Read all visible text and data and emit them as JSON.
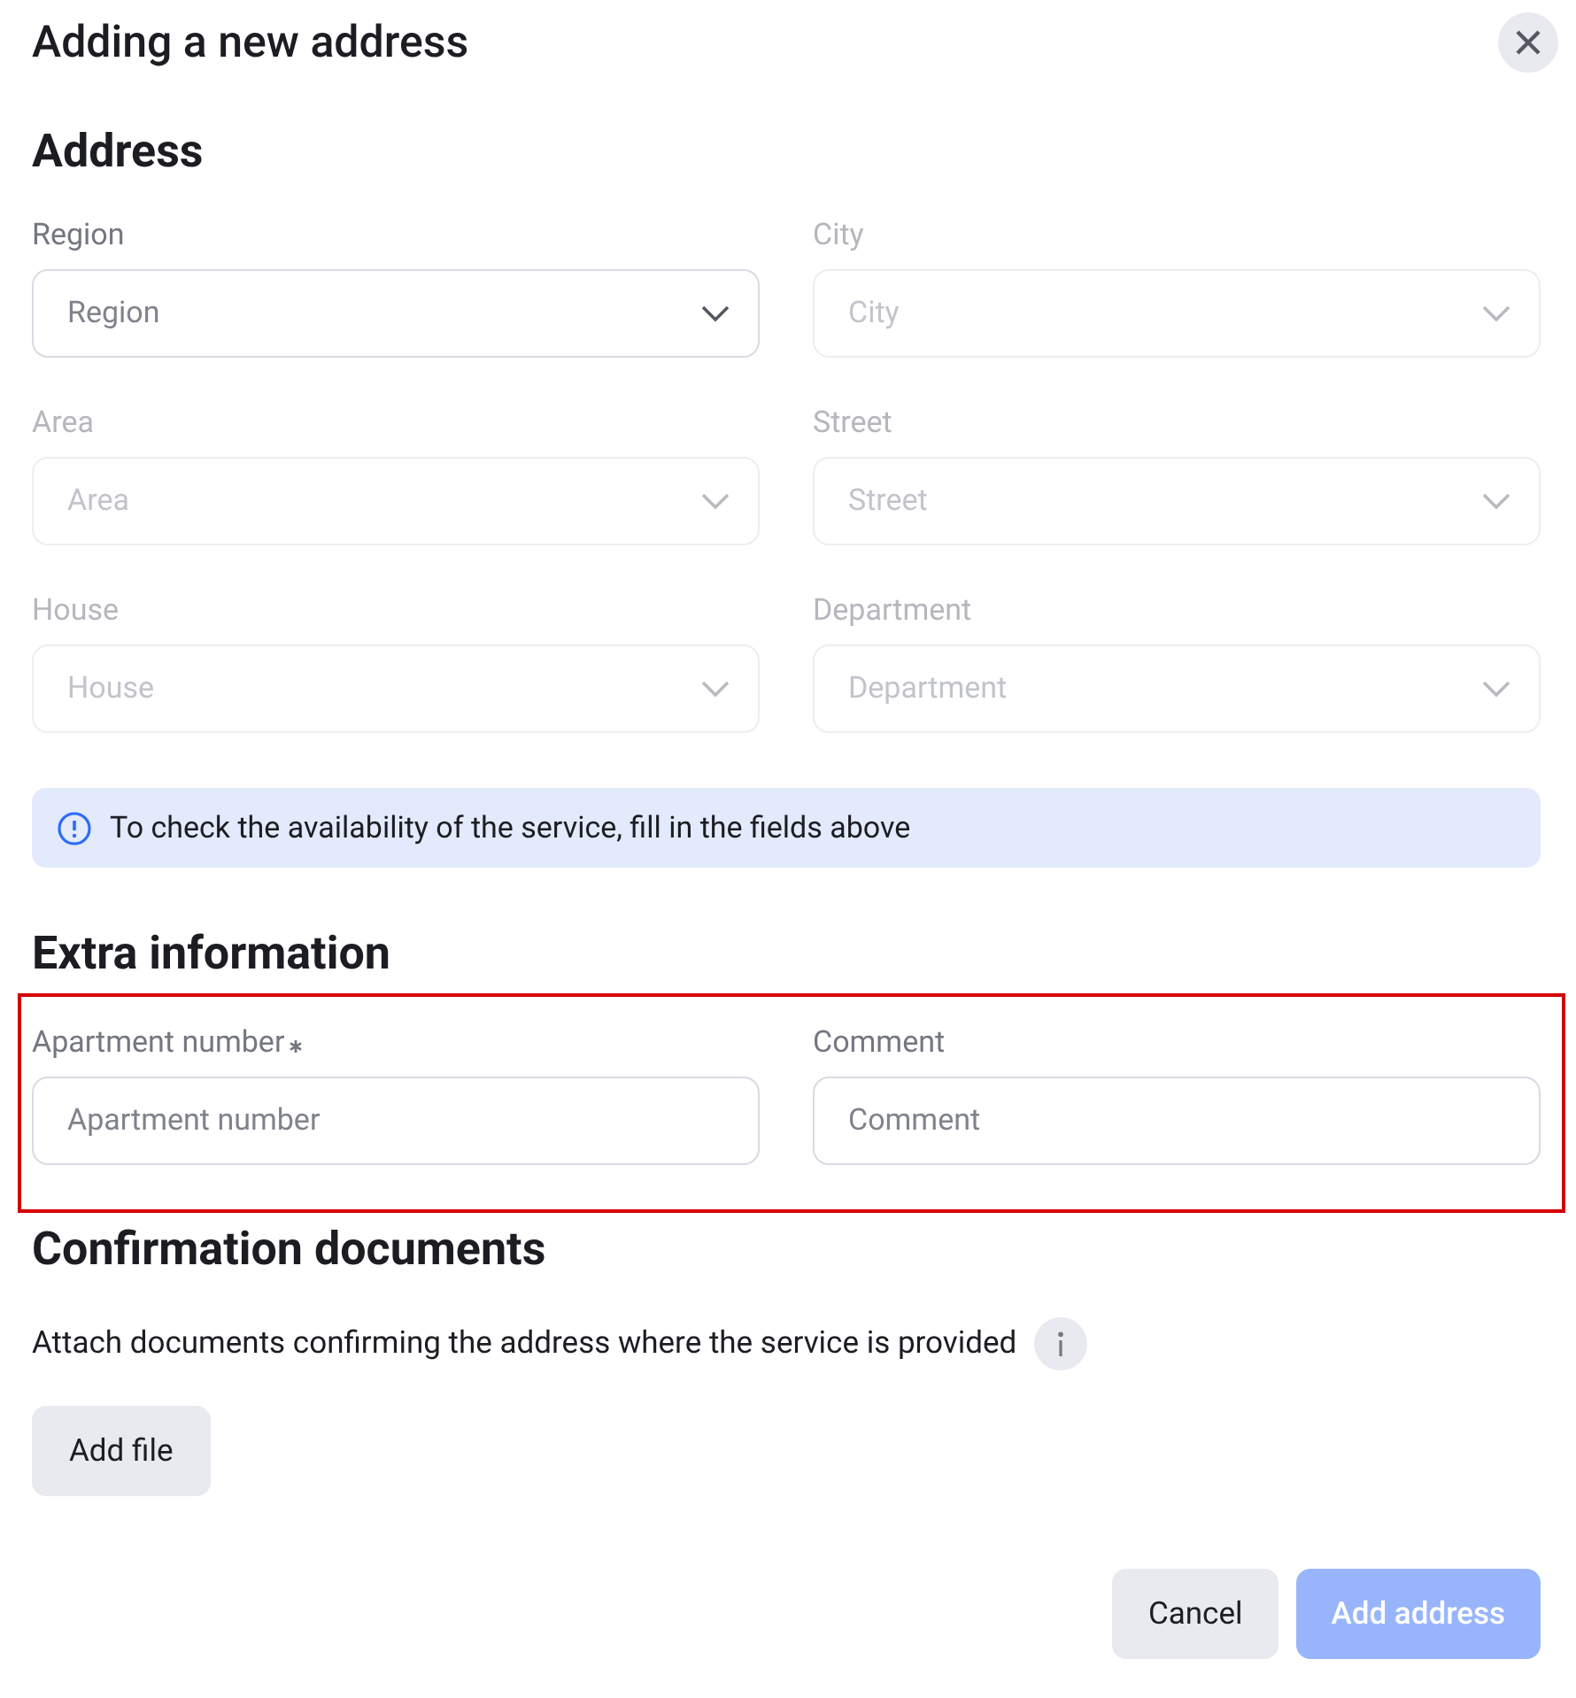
{
  "dialog": {
    "title": "Adding a new address"
  },
  "address": {
    "heading": "Address",
    "fields": [
      {
        "label": "Region",
        "placeholder": "Region",
        "kind": "select",
        "disabled": false
      },
      {
        "label": "City",
        "placeholder": "City",
        "kind": "select",
        "disabled": true
      },
      {
        "label": "Area",
        "placeholder": "Area",
        "kind": "select",
        "disabled": true
      },
      {
        "label": "Street",
        "placeholder": "Street",
        "kind": "select",
        "disabled": true
      },
      {
        "label": "House",
        "placeholder": "House",
        "kind": "select",
        "disabled": true
      },
      {
        "label": "Department",
        "placeholder": "Department",
        "kind": "select",
        "disabled": true
      }
    ],
    "notice": "To check the availability of the service, fill in the fields above"
  },
  "extra": {
    "heading": "Extra information",
    "highlighted": true,
    "fields": [
      {
        "label": "Apartment number",
        "placeholder": "Apartment number",
        "kind": "text",
        "required": true,
        "disabled": false
      },
      {
        "label": "Comment",
        "placeholder": "Comment",
        "kind": "text",
        "required": false,
        "disabled": false
      }
    ]
  },
  "documents": {
    "heading": "Confirmation documents",
    "text": "Attach documents confirming the address where the service is provided",
    "button": "Add file"
  },
  "buttons": [
    {
      "label": "Cancel",
      "kind": "secondary",
      "disabled": false
    },
    {
      "label": "Add address",
      "kind": "primary",
      "disabled": true
    }
  ]
}
